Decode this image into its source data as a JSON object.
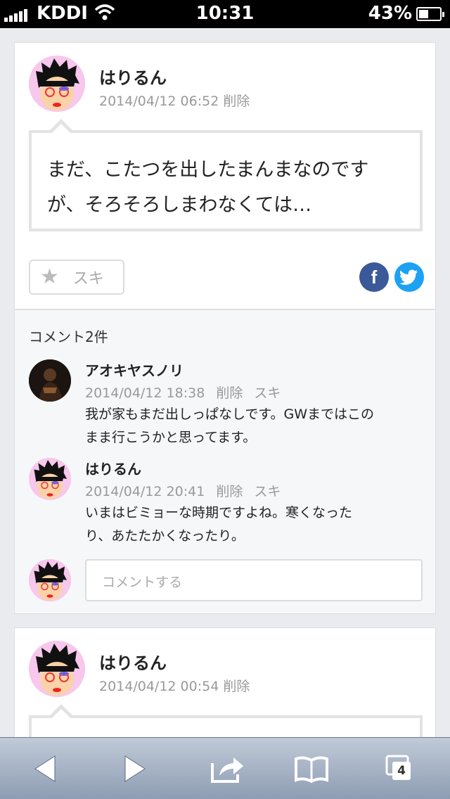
{
  "status_bar": {
    "carrier": "KDDI",
    "time": "10:31",
    "battery": "43%"
  },
  "posts": [
    {
      "author": "はりるん",
      "timestamp": "2014/04/12 06:52",
      "delete_label": "削除",
      "body_lines": [
        "まだ、こたつを出したまんまなのです",
        "が、そろそろしまわなくては…"
      ],
      "like_label": "スキ",
      "comments_heading": "コメント2件",
      "comments": [
        {
          "author": "アオキヤスノリ",
          "timestamp": "2014/04/12 18:38",
          "delete_label": "削除",
          "like_label": "スキ",
          "text_lines": [
            "我が家もまだ出しっぱなしです。GWまではこの",
            "まま行こうかと思ってます。"
          ]
        },
        {
          "author": "はりるん",
          "timestamp": "2014/04/12 20:41",
          "delete_label": "削除",
          "like_label": "スキ",
          "text_lines": [
            "いまはビミョーな時期ですよね。寒くなった",
            "り、あたたかくなったり。"
          ]
        }
      ],
      "comment_placeholder": "コメントする"
    },
    {
      "author": "はりるん",
      "timestamp": "2014/04/12 00:54",
      "delete_label": "削除"
    }
  ],
  "toolbar": {
    "tab_count": "4"
  },
  "icons": {
    "share_facebook": "f",
    "share_twitter": "twitter-bird-icon",
    "like": "star-icon"
  },
  "colors": {
    "facebook": "#3b5998",
    "twitter": "#1da1f2",
    "avatar_bg": "#f7c7ec"
  }
}
